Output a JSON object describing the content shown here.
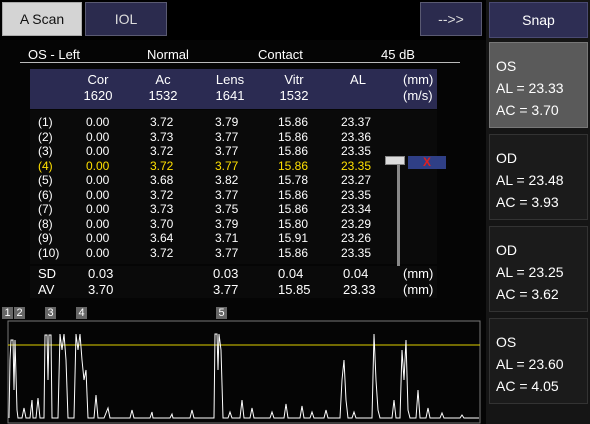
{
  "tabs": {
    "ascan": "A Scan",
    "iol": "IOL",
    "next": "-->>"
  },
  "snap": "Snap",
  "info": {
    "eye": "OS - Left",
    "mode": "Normal",
    "method": "Contact",
    "gain": "45  dB"
  },
  "columns": {
    "cor": {
      "label": "Cor",
      "velocity": "1620"
    },
    "ac": {
      "label": "Ac",
      "velocity": "1532"
    },
    "lens": {
      "label": "Lens",
      "velocity": "1641"
    },
    "vitr": {
      "label": "Vitr",
      "velocity": "1532"
    },
    "al": {
      "label": "AL"
    },
    "unit_mm": "(mm)",
    "unit_ms": "(m/s)"
  },
  "rows": [
    {
      "n": "(1)",
      "cor": "0.00",
      "ac": "3.72",
      "lens": "3.79",
      "vitr": "15.86",
      "al": "23.37"
    },
    {
      "n": "(2)",
      "cor": "0.00",
      "ac": "3.73",
      "lens": "3.77",
      "vitr": "15.86",
      "al": "23.36"
    },
    {
      "n": "(3)",
      "cor": "0.00",
      "ac": "3.72",
      "lens": "3.77",
      "vitr": "15.86",
      "al": "23.35"
    },
    {
      "n": "(4)",
      "cor": "0.00",
      "ac": "3.72",
      "lens": "3.77",
      "vitr": "15.86",
      "al": "23.35"
    },
    {
      "n": "(5)",
      "cor": "0.00",
      "ac": "3.68",
      "lens": "3.82",
      "vitr": "15.78",
      "al": "23.27"
    },
    {
      "n": "(6)",
      "cor": "0.00",
      "ac": "3.72",
      "lens": "3.77",
      "vitr": "15.86",
      "al": "23.35"
    },
    {
      "n": "(7)",
      "cor": "0.00",
      "ac": "3.73",
      "lens": "3.75",
      "vitr": "15.86",
      "al": "23.34"
    },
    {
      "n": "(8)",
      "cor": "0.00",
      "ac": "3.70",
      "lens": "3.79",
      "vitr": "15.80",
      "al": "23.29"
    },
    {
      "n": "(9)",
      "cor": "0.00",
      "ac": "3.64",
      "lens": "3.71",
      "vitr": "15.91",
      "al": "23.26"
    },
    {
      "n": "(10)",
      "cor": "0.00",
      "ac": "3.72",
      "lens": "3.77",
      "vitr": "15.86",
      "al": "23.35"
    }
  ],
  "delete_row_label": "X",
  "stats": {
    "sd": {
      "label": "SD",
      "cor": "0.03",
      "lens": "0.03",
      "vitr": "0.04",
      "al": "0.04",
      "unit": "(mm)"
    },
    "av": {
      "label": "AV",
      "cor": "3.70",
      "lens": "3.77",
      "vitr": "15.85",
      "al": "23.33",
      "unit": "(mm)"
    }
  },
  "markers": [
    "1",
    "2",
    "3",
    "4",
    "5"
  ],
  "colors": {
    "highlight": "#ffe000",
    "gate": "#e0d000",
    "trace": "#ffffff",
    "header_bg": "#2b2b52"
  },
  "cards": [
    {
      "eye": "OS",
      "al": "AL = 23.33",
      "ac": "AC = 3.70"
    },
    {
      "eye": "OD",
      "al": "AL = 23.48",
      "ac": "AC = 3.93"
    },
    {
      "eye": "OD",
      "al": "AL = 23.25",
      "ac": "AC = 3.62"
    },
    {
      "eye": "OS",
      "al": "AL = 23.60",
      "ac": "AC = 4.05"
    }
  ]
}
